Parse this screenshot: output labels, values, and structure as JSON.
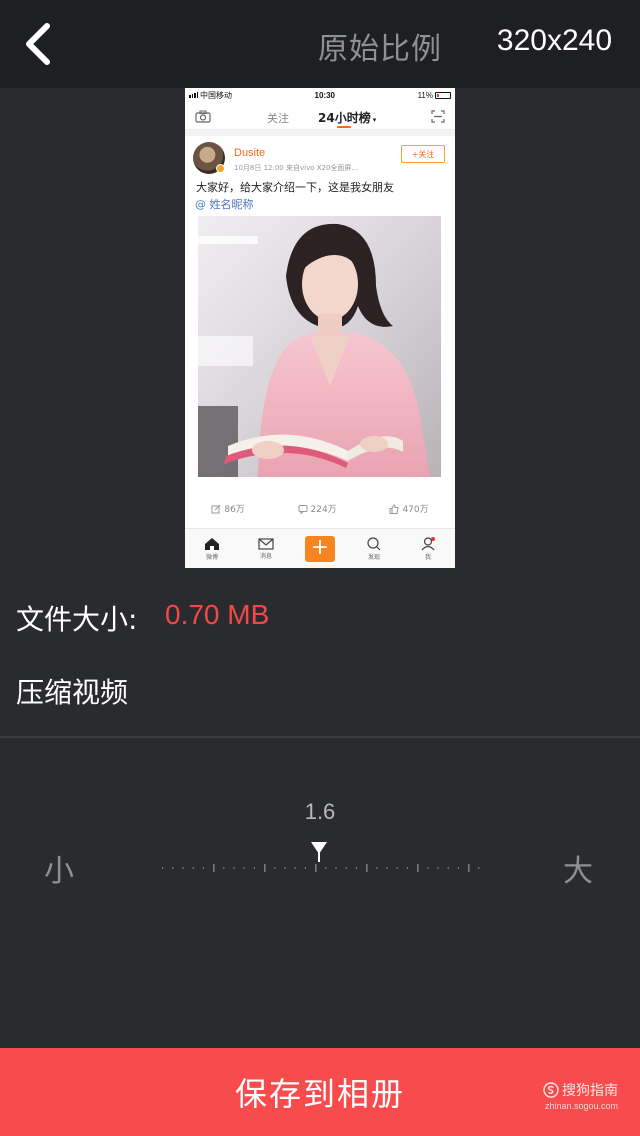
{
  "header": {
    "ratio_label": "原始比例",
    "size_label": "320x240"
  },
  "preview": {
    "status_bar": {
      "carrier": "中国移动",
      "time": "10:30",
      "battery": "11%"
    },
    "nav": {
      "follow_tab": "关注",
      "hot_tab": "24小时榜"
    },
    "post": {
      "username": "Dusite",
      "meta": "10月8日 12:00  来自vivo X20全面屏...",
      "follow_button": "+关注",
      "text": "大家好，给大家介绍一下，这是我女朋友",
      "mention": "@ 姓名昵称",
      "stats": {
        "reposts": "86万",
        "comments": "224万",
        "likes": "470万"
      }
    },
    "tabbar": [
      {
        "label": "微博"
      },
      {
        "label": "消息"
      },
      {
        "label": "+"
      },
      {
        "label": "发现"
      },
      {
        "label": "我"
      }
    ]
  },
  "file_size": {
    "label": "文件大小:",
    "value": "0.70 MB"
  },
  "compress": {
    "label": "压缩视频"
  },
  "slider": {
    "value": "1.6",
    "min_label": "小",
    "max_label": "大"
  },
  "save_button": {
    "label": "保存到相册"
  },
  "watermark": {
    "brand": "搜狗指南",
    "url": "zhinan.sogou.com"
  },
  "colors": {
    "background": "#2a2b2f",
    "topbar": "#1e1f22",
    "accent_red": "#f84b4e",
    "size_value": "#f34848"
  }
}
